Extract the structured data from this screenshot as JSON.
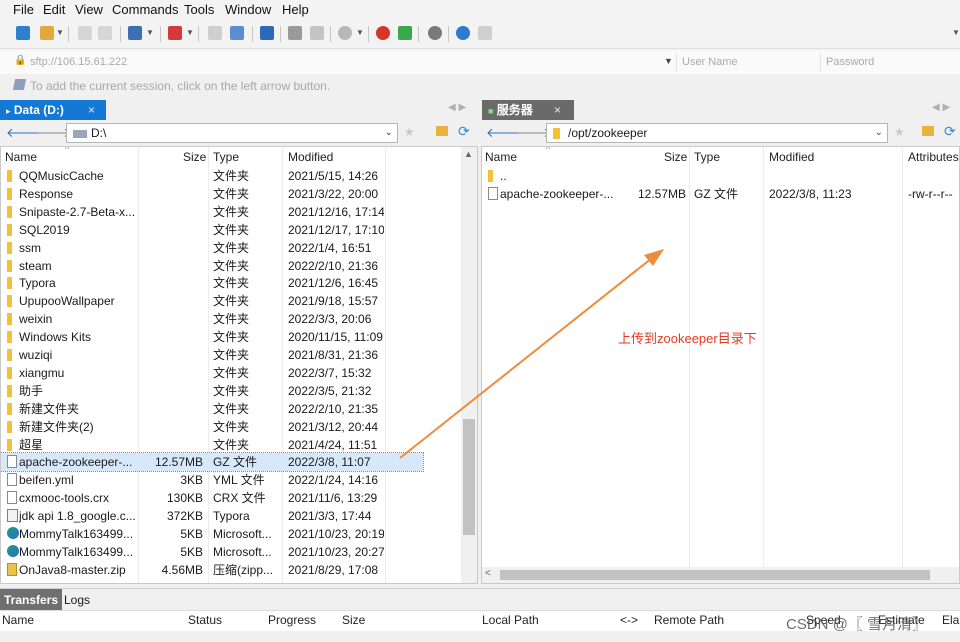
{
  "menu": [
    "File",
    "Edit",
    "View",
    "Commands",
    "Tools",
    "Window",
    "Help"
  ],
  "session": {
    "address": "sftp://106.15.61.222",
    "username_placeholder": "User Name",
    "password_placeholder": "Password",
    "notice": "To add the current session, click on the left arrow button."
  },
  "left": {
    "tab_label": "Data (D:)",
    "tab_close": "×",
    "path": "D:\\",
    "columns": [
      "Name",
      "Size",
      "Type",
      "Modified"
    ],
    "rows": [
      {
        "name": "QQMusicCache",
        "size": "",
        "type": "文件夹",
        "modified": "2021/5/15, 14:26",
        "icon": "folder"
      },
      {
        "name": "Response",
        "size": "",
        "type": "文件夹",
        "modified": "2021/3/22, 20:00",
        "icon": "folder"
      },
      {
        "name": "Snipaste-2.7-Beta-x...",
        "size": "",
        "type": "文件夹",
        "modified": "2021/12/16, 17:14",
        "icon": "folder"
      },
      {
        "name": "SQL2019",
        "size": "",
        "type": "文件夹",
        "modified": "2021/12/17, 17:10",
        "icon": "folder"
      },
      {
        "name": "ssm",
        "size": "",
        "type": "文件夹",
        "modified": "2022/1/4, 16:51",
        "icon": "folder"
      },
      {
        "name": "steam",
        "size": "",
        "type": "文件夹",
        "modified": "2022/2/10, 21:36",
        "icon": "folder"
      },
      {
        "name": "Typora",
        "size": "",
        "type": "文件夹",
        "modified": "2021/12/6, 16:45",
        "icon": "folder"
      },
      {
        "name": "UpupooWallpaper",
        "size": "",
        "type": "文件夹",
        "modified": "2021/9/18, 15:57",
        "icon": "folder"
      },
      {
        "name": "weixin",
        "size": "",
        "type": "文件夹",
        "modified": "2022/3/3, 20:06",
        "icon": "folder"
      },
      {
        "name": "Windows Kits",
        "size": "",
        "type": "文件夹",
        "modified": "2020/11/15, 11:09",
        "icon": "folder"
      },
      {
        "name": "wuziqi",
        "size": "",
        "type": "文件夹",
        "modified": "2021/8/31, 21:36",
        "icon": "folder"
      },
      {
        "name": "xiangmu",
        "size": "",
        "type": "文件夹",
        "modified": "2022/3/7, 15:32",
        "icon": "folder"
      },
      {
        "name": "助手",
        "size": "",
        "type": "文件夹",
        "modified": "2022/3/5, 21:32",
        "icon": "folder"
      },
      {
        "name": "新建文件夹",
        "size": "",
        "type": "文件夹",
        "modified": "2022/2/10, 21:35",
        "icon": "folder"
      },
      {
        "name": "新建文件夹(2)",
        "size": "",
        "type": "文件夹",
        "modified": "2021/3/12, 20:44",
        "icon": "folder"
      },
      {
        "name": "超星",
        "size": "",
        "type": "文件夹",
        "modified": "2021/4/24, 11:51",
        "icon": "folder"
      },
      {
        "name": "apache-zookeeper-...",
        "size": "12.57MB",
        "type": "GZ 文件",
        "modified": "2022/3/8, 11:07",
        "icon": "file",
        "selected": true
      },
      {
        "name": "beifen.yml",
        "size": "3KB",
        "type": "YML 文件",
        "modified": "2022/1/24, 14:16",
        "icon": "file"
      },
      {
        "name": "cxmooc-tools.crx",
        "size": "130KB",
        "type": "CRX 文件",
        "modified": "2021/11/6, 13:29",
        "icon": "file"
      },
      {
        "name": "jdk api 1.8_google.c...",
        "size": "372KB",
        "type": "Typora",
        "modified": "2021/3/3, 17:44",
        "icon": "jdk"
      },
      {
        "name": "MommyTalk163499...",
        "size": "5KB",
        "type": "Microsoft...",
        "modified": "2021/10/23, 20:19",
        "icon": "edge"
      },
      {
        "name": "MommyTalk163499...",
        "size": "5KB",
        "type": "Microsoft...",
        "modified": "2021/10/23, 20:27",
        "icon": "edge"
      },
      {
        "name": "OnJava8-master.zip",
        "size": "4.56MB",
        "type": "压缩(zipp...",
        "modified": "2021/8/29, 17:08",
        "icon": "zip"
      }
    ]
  },
  "right": {
    "tab_label": "服务器",
    "tab_close": "×",
    "path": "/opt/zookeeper",
    "columns": [
      "Name",
      "Size",
      "Type",
      "Modified",
      "Attributes"
    ],
    "rows": [
      {
        "name": "..",
        "size": "",
        "type": "",
        "modified": "",
        "attributes": "",
        "icon": "folder"
      },
      {
        "name": "apache-zookeeper-...",
        "size": "12.57MB",
        "type": "GZ 文件",
        "modified": "2022/3/8, 11:23",
        "attributes": "-rw-r--r--",
        "icon": "file"
      }
    ]
  },
  "bottom": {
    "tabs": [
      "Transfers",
      "Logs"
    ],
    "columns": [
      "Name",
      "Status",
      "Progress",
      "Size",
      "Local Path",
      "<->",
      "Remote Path",
      "Speed",
      "Estimate",
      "Ela"
    ]
  },
  "annotation": "上传到zookeeper目录下",
  "watermark": "CSDN @〖 雪月清〗",
  "colors": {
    "accent": "#1478d6",
    "annotation": "#e53a1f",
    "arrow": "#f08a3c"
  }
}
